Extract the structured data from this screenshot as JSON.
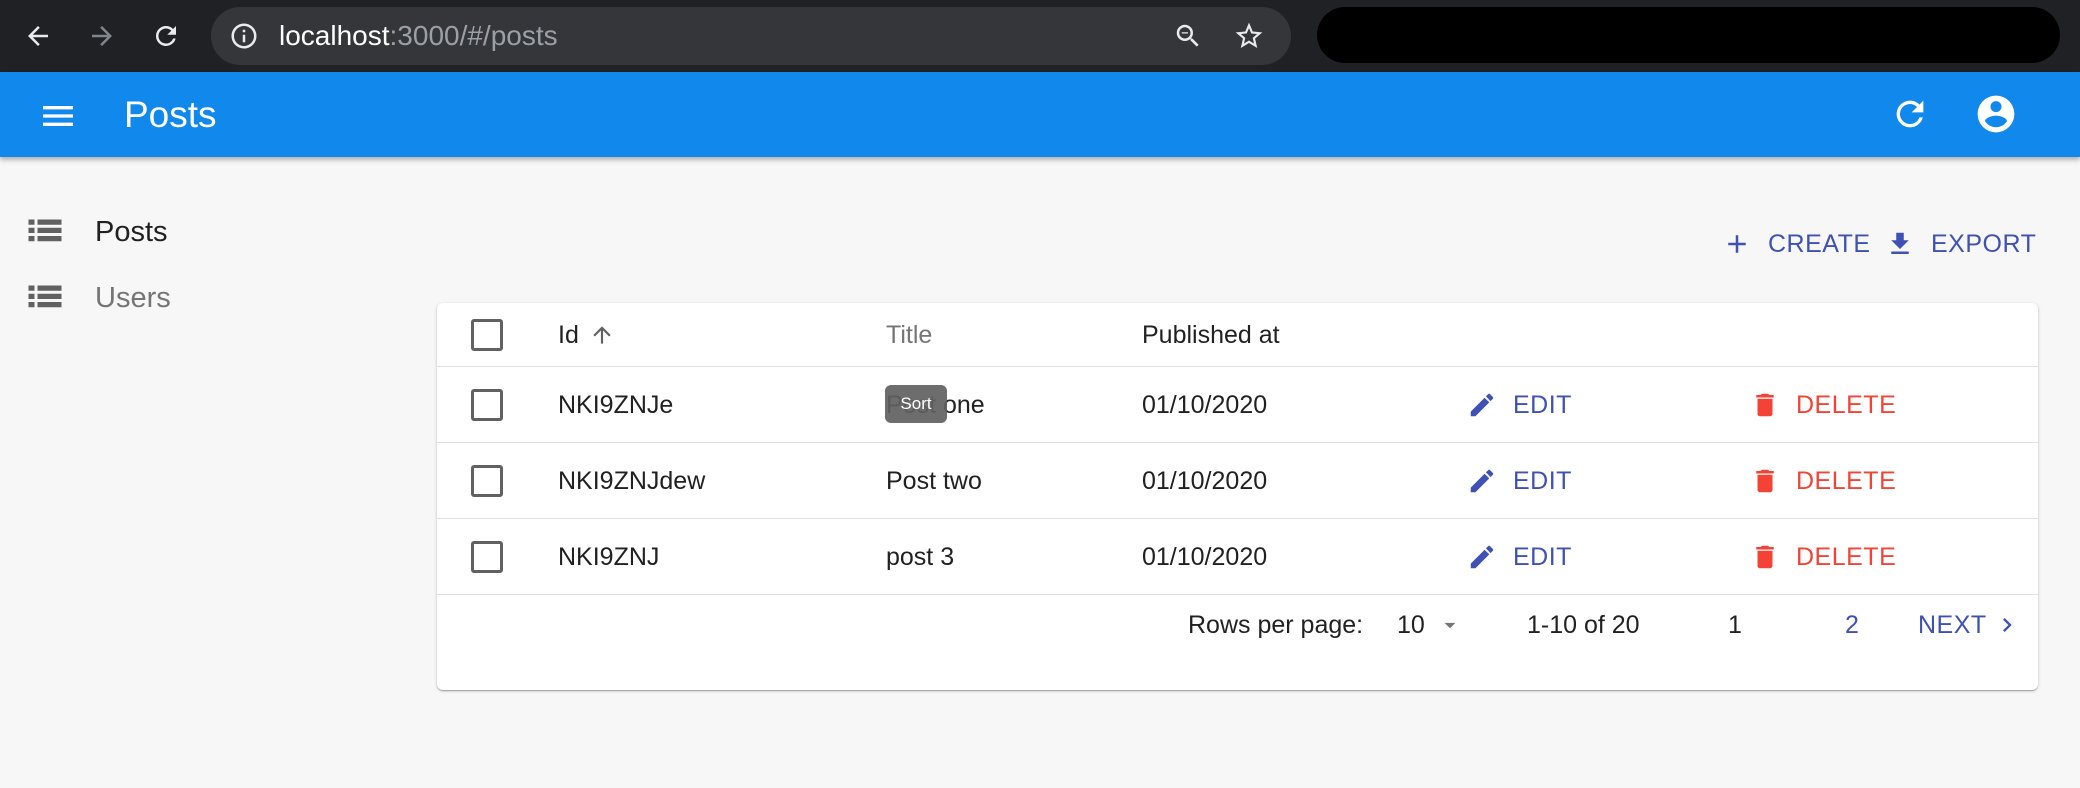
{
  "browser": {
    "url_host": "localhost",
    "url_rest": ":3000/#/posts"
  },
  "appbar": {
    "title": "Posts"
  },
  "sidebar": {
    "items": [
      {
        "label": "Posts",
        "icon": "list-icon",
        "active": true
      },
      {
        "label": "Users",
        "icon": "list-icon",
        "active": false
      }
    ]
  },
  "toolbar": {
    "create_label": "CREATE",
    "export_label": "EXPORT"
  },
  "table": {
    "columns": {
      "id": "Id",
      "title": "Title",
      "published_at": "Published at"
    },
    "sorted_by": "id",
    "sort_direction": "ascending",
    "rows": [
      {
        "id": "NKI9ZNJe",
        "title": "Post one",
        "published_at": "01/10/2020",
        "edit_label": "EDIT",
        "delete_label": "DELETE"
      },
      {
        "id": "NKI9ZNJdew",
        "title": "Post two",
        "published_at": "01/10/2020",
        "edit_label": "EDIT",
        "delete_label": "DELETE"
      },
      {
        "id": "NKI9ZNJ",
        "title": "post 3",
        "published_at": "01/10/2020",
        "edit_label": "EDIT",
        "delete_label": "DELETE"
      }
    ],
    "tooltip": "Sort"
  },
  "pagination": {
    "rows_per_page_label": "Rows per page:",
    "rows_per_page_value": "10",
    "range_label": "1-10 of 20",
    "pages": [
      "1",
      "2"
    ],
    "current_page": "1",
    "next_label": "NEXT"
  },
  "colors": {
    "appbar": "#1189ec",
    "primary": "#3f51b5",
    "danger": "#f44336"
  }
}
